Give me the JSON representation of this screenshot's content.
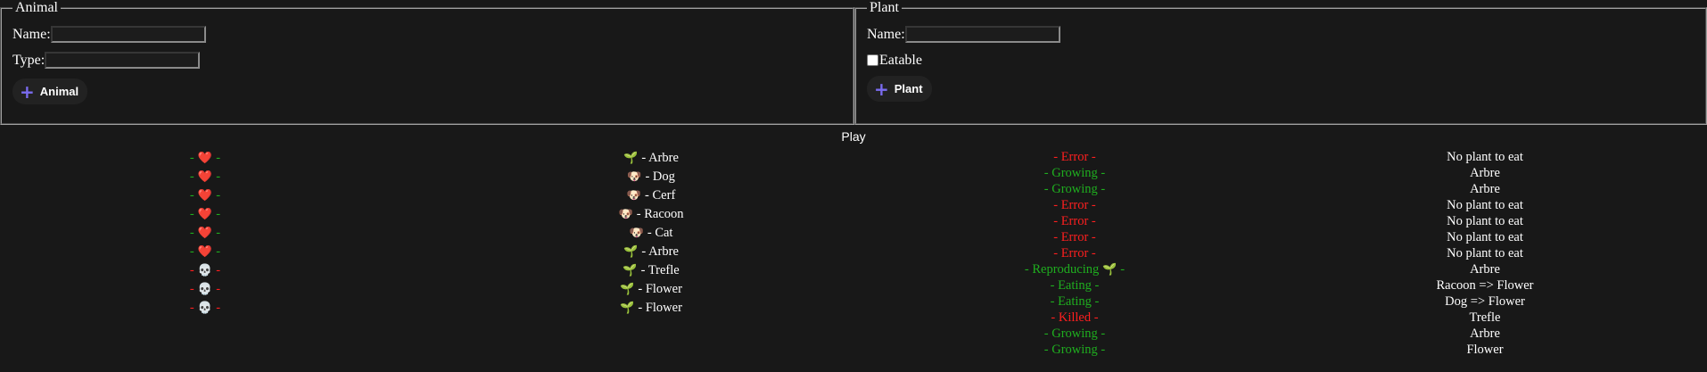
{
  "animal": {
    "legend": "Animal",
    "name_label": "Name:",
    "name_value": "",
    "type_label": "Type:",
    "type_value": "",
    "add_label": "Animal"
  },
  "plant": {
    "legend": "Plant",
    "name_label": "Name:",
    "name_value": "",
    "eatable_label": "Eatable",
    "eatable_checked": false,
    "add_label": "Plant"
  },
  "play_label": "Play",
  "health": [
    {
      "status": "alive",
      "dash": "-"
    },
    {
      "status": "alive",
      "dash": "-"
    },
    {
      "status": "alive",
      "dash": "-"
    },
    {
      "status": "alive",
      "dash": "-"
    },
    {
      "status": "alive",
      "dash": "-"
    },
    {
      "status": "alive",
      "dash": "-"
    },
    {
      "status": "dead",
      "dash": "-"
    },
    {
      "status": "dead",
      "dash": "-"
    },
    {
      "status": "dead",
      "dash": "-"
    }
  ],
  "icons": {
    "alive": "❤️",
    "dead": "💀",
    "plant": "🌱",
    "animal": "🐶"
  },
  "entities": [
    {
      "kind": "plant",
      "name": "Arbre"
    },
    {
      "kind": "animal",
      "name": "Dog"
    },
    {
      "kind": "animal",
      "name": "Cerf"
    },
    {
      "kind": "animal",
      "name": "Racoon"
    },
    {
      "kind": "animal",
      "name": "Cat"
    },
    {
      "kind": "plant",
      "name": "Arbre"
    },
    {
      "kind": "plant",
      "name": "Trefle"
    },
    {
      "kind": "plant",
      "name": "Flower"
    },
    {
      "kind": "plant",
      "name": "Flower"
    }
  ],
  "actions": [
    {
      "text": "Error",
      "color": "#ff1f1f"
    },
    {
      "text": "Growing",
      "color": "#1fae1f"
    },
    {
      "text": "Growing",
      "color": "#1fae1f"
    },
    {
      "text": "Error",
      "color": "#ff1f1f"
    },
    {
      "text": "Error",
      "color": "#ff1f1f"
    },
    {
      "text": "Error",
      "color": "#ff1f1f"
    },
    {
      "text": "Error",
      "color": "#ff1f1f"
    },
    {
      "text": "Reproducing",
      "color": "#1fae1f",
      "icon": "🌱"
    },
    {
      "text": "Eating",
      "color": "#1fae1f"
    },
    {
      "text": "Eating",
      "color": "#1fae1f"
    },
    {
      "text": "Killed",
      "color": "#ff1f1f"
    },
    {
      "text": "Growing",
      "color": "#1fae1f"
    },
    {
      "text": "Growing",
      "color": "#1fae1f"
    }
  ],
  "results": [
    "No plant to eat",
    "Arbre",
    "Arbre",
    "No plant to eat",
    "No plant to eat",
    "No plant to eat",
    "No plant to eat",
    "Arbre",
    "Racoon => Flower",
    "Dog => Flower",
    "Trefle",
    "Arbre",
    "Flower"
  ]
}
